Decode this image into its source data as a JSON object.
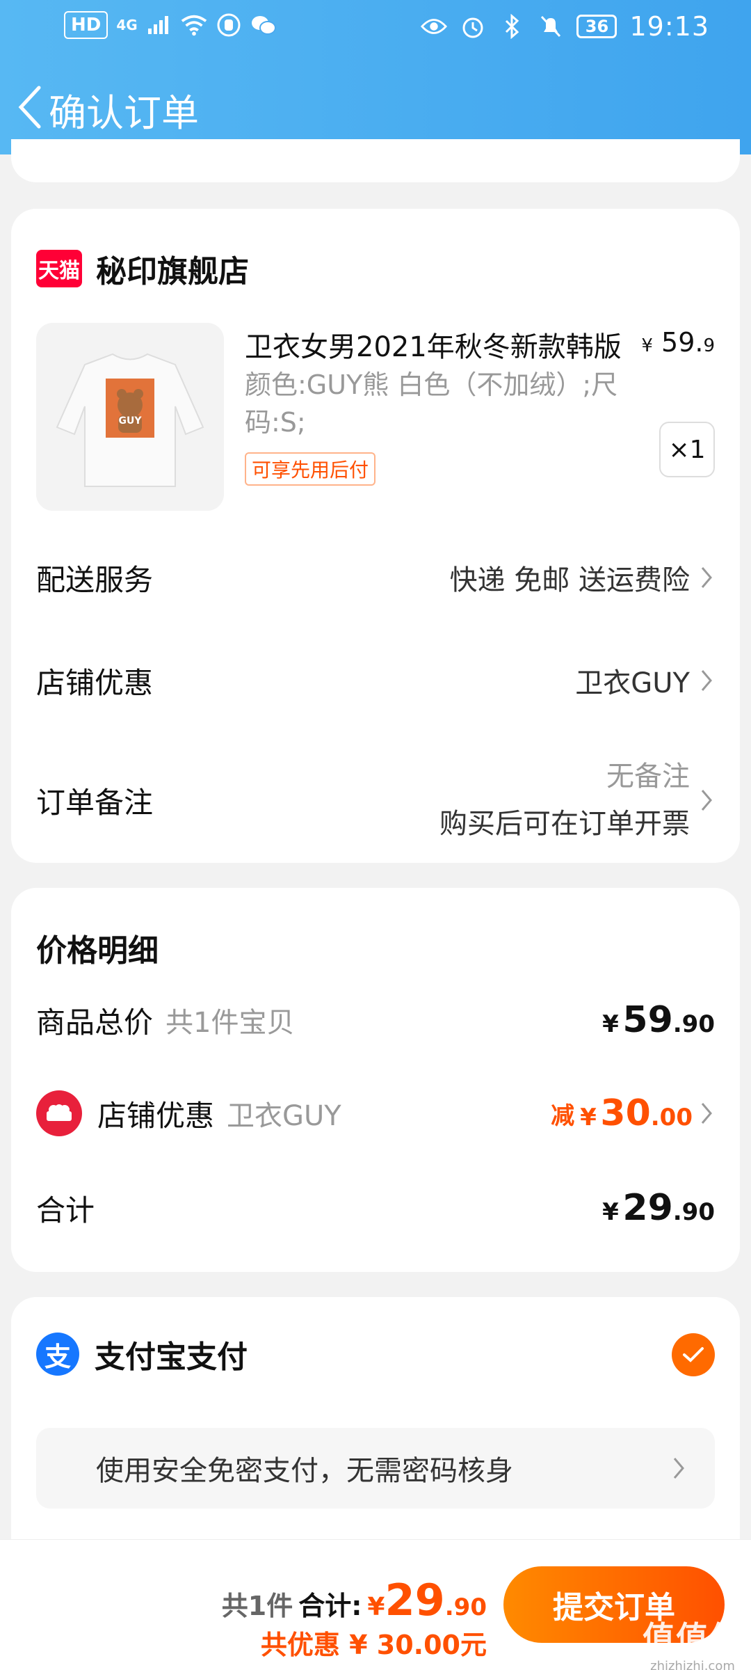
{
  "status_bar": {
    "hd": "HD",
    "network": "4G",
    "battery": "36",
    "time": "19:13"
  },
  "nav": {
    "title": "确认订单"
  },
  "shop": {
    "logo_text": "天猫",
    "name": "秘印旗舰店",
    "product": {
      "title": "卫衣女男2021年秋冬新款韩版",
      "price_symbol": "¥",
      "price_main": "59.",
      "price_decimal": "9",
      "sku": "颜色:GUY熊 白色（不加绒）;尺码:S;",
      "tag": "可享先用后付",
      "quantity": "×1",
      "image_text": "GUY"
    },
    "rows": {
      "delivery_label": "配送服务",
      "delivery_value": "快递 免邮 送运费险",
      "coupon_label": "店铺优惠",
      "coupon_value": "卫衣GUY",
      "note_label": "订单备注",
      "note_placeholder": "无备注",
      "note_invoice": "购买后可在订单开票"
    }
  },
  "price_detail": {
    "title": "价格明细",
    "goods_label": "商品总价",
    "goods_sub": "共1件宝贝",
    "goods_cur": "¥",
    "goods_int": "59",
    "goods_dec": ".90",
    "discount_label": "店铺优惠",
    "discount_sub": "卫衣GUY",
    "discount_minus": "减",
    "discount_cur": "¥",
    "discount_int": "30",
    "discount_dec": ".00",
    "total_label": "合计",
    "total_cur": "¥",
    "total_int": "29",
    "total_dec": ".90"
  },
  "payment": {
    "icon_text": "支",
    "name": "支付宝支付",
    "tip": "使用安全免密支付，无需密码核身",
    "selected": true
  },
  "bottom_bar": {
    "count": "共1件",
    "total_label": "合计:",
    "total_cur": "¥",
    "total_int": "29",
    "total_dec": ".90",
    "saved": "共优惠 ¥ 30.00元",
    "submit": "提交订单"
  },
  "watermark": {
    "main": "值值值",
    "sub": "zhizhizhi.com"
  },
  "colors": {
    "header": "#3fa4ee",
    "accent": "#ff5000",
    "tmall": "#ff0036",
    "alipay": "#1677ff"
  }
}
